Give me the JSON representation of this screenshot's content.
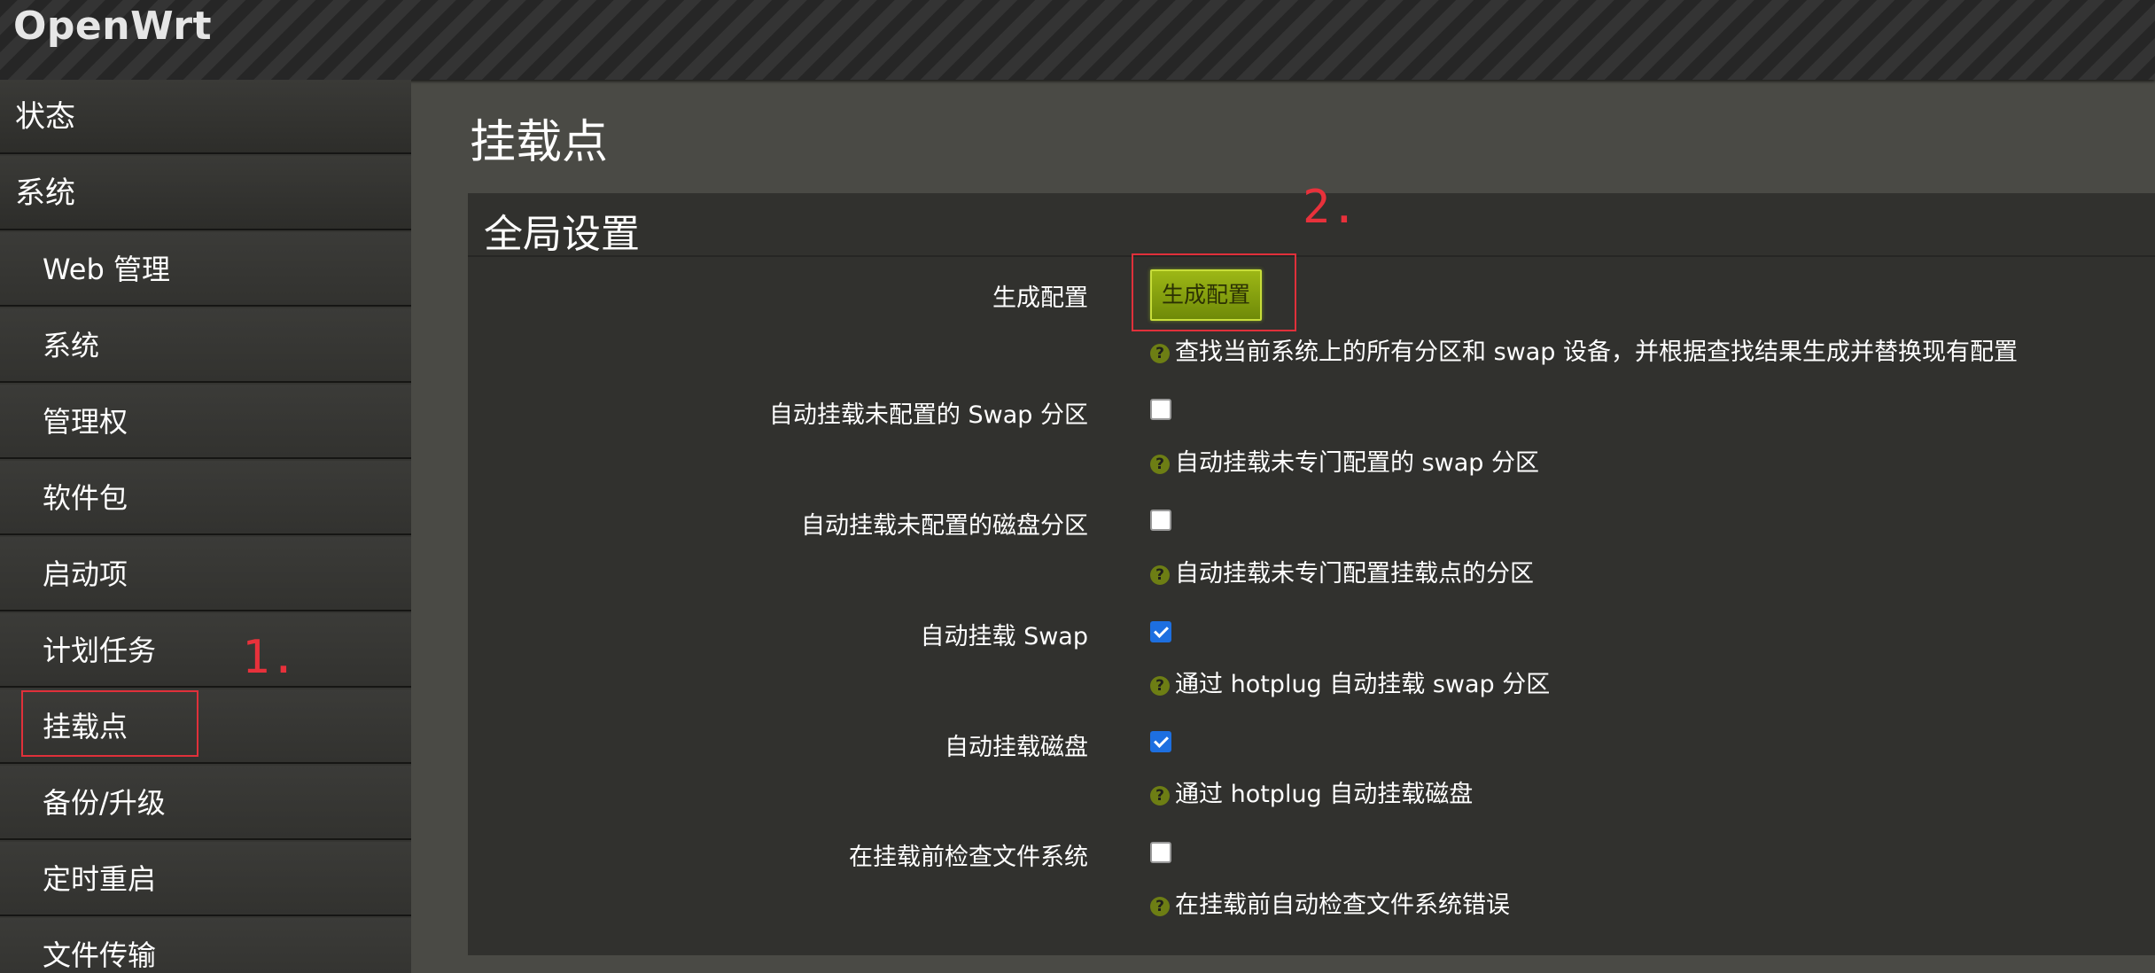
{
  "brand": "OpenWrt",
  "nav": {
    "status": "状态",
    "system": "系统",
    "sub_items": [
      "Web 管理",
      "系统",
      "管理权",
      "软件包",
      "启动项",
      "计划任务",
      "挂载点",
      "备份/升级",
      "定时重启",
      "文件传输"
    ]
  },
  "annotations": {
    "step1": "1.",
    "step2": "2."
  },
  "page": {
    "title": "挂载点"
  },
  "section": {
    "title": "全局设置",
    "generate": {
      "label": "生成配置",
      "button": "生成配置",
      "help": "查找当前系统上的所有分区和 swap 设备，并根据查找结果生成并替换现有配置"
    },
    "options": [
      {
        "label": "自动挂载未配置的 Swap 分区",
        "checked": false,
        "help": "自动挂载未专门配置的 swap 分区"
      },
      {
        "label": "自动挂载未配置的磁盘分区",
        "checked": false,
        "help": "自动挂载未专门配置挂载点的分区"
      },
      {
        "label": "自动挂载 Swap",
        "checked": true,
        "help": "通过 hotplug 自动挂载 swap 分区"
      },
      {
        "label": "自动挂载磁盘",
        "checked": true,
        "help": "通过 hotplug 自动挂载磁盘"
      },
      {
        "label": "在挂载前检查文件系统",
        "checked": false,
        "help": "在挂载前自动检查文件系统错误"
      }
    ]
  },
  "colors": {
    "accent": "#8aa80f",
    "highlight": "#e0303a",
    "checkbox_checked": "#1d6fe0"
  }
}
